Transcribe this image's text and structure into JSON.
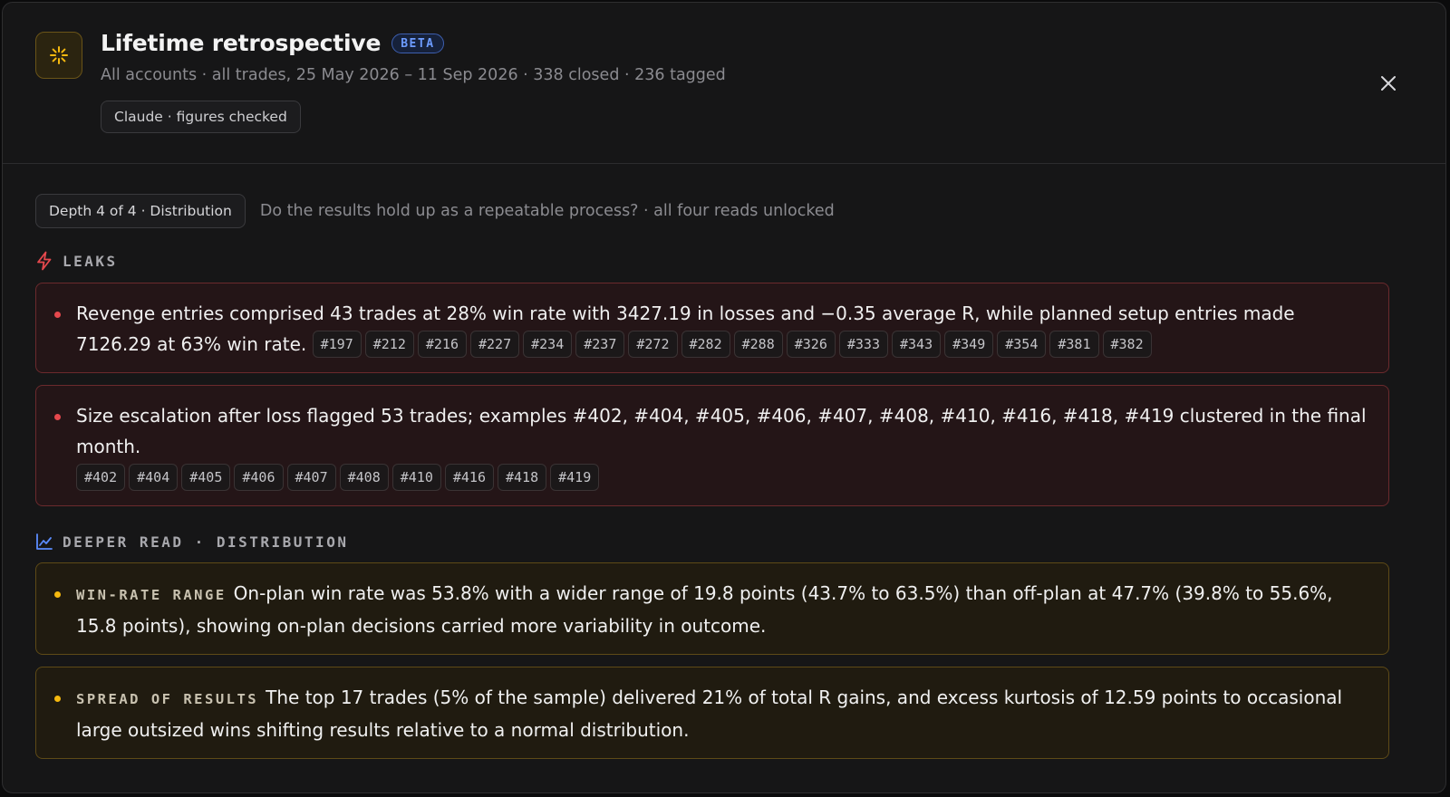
{
  "header": {
    "title": "Lifetime retrospective",
    "badge": "BETA",
    "subtitle": "All accounts · all trades, 25 May 2026 – 11 Sep 2026 · 338 closed · 236 tagged",
    "checked_chip": "Claude · figures checked",
    "app_icon": "sparkle-icon",
    "close_icon": "close-icon"
  },
  "depth": {
    "chip": "Depth 4 of 4 · Distribution",
    "description": "Do the results hold up as a repeatable process? · all four reads unlocked"
  },
  "leaks": {
    "heading": "LEAKS",
    "icon": "lightning-icon",
    "accent": "#e5484d",
    "items": [
      {
        "text": "Revenge entries comprised 43 trades at 28% win rate with 3427.19 in losses and −0.35 average R, while planned setup entries made 7126.29 at 63% win rate.",
        "tags": [
          "#197",
          "#212",
          "#216",
          "#227",
          "#234",
          "#237",
          "#272",
          "#282",
          "#288",
          "#326",
          "#333",
          "#343",
          "#349",
          "#354",
          "#381",
          "#382"
        ]
      },
      {
        "text": "Size escalation after loss flagged 53 trades; examples #402, #404, #405, #406, #407, #408, #410, #416, #418, #419 clustered in the final month.",
        "tags": [
          "#402",
          "#404",
          "#405",
          "#406",
          "#407",
          "#408",
          "#410",
          "#416",
          "#418",
          "#419"
        ]
      }
    ]
  },
  "deeper": {
    "heading": "DEEPER READ · DISTRIBUTION",
    "icon": "line-chart-icon",
    "accent": "#f5b90f",
    "items": [
      {
        "kicker": "WIN-RATE RANGE",
        "text": "On-plan win rate was 53.8% with a wider range of 19.8 points (43.7% to 63.5%) than off-plan at 47.7% (39.8% to 55.6%, 15.8 points), showing on-plan decisions carried more variability in outcome."
      },
      {
        "kicker": "SPREAD OF RESULTS",
        "text": "The top 17 trades (5% of the sample) delivered 21% of total R gains, and excess kurtosis of 12.59 points to occasional large outsized wins shifting results relative to a normal distribution."
      }
    ]
  }
}
